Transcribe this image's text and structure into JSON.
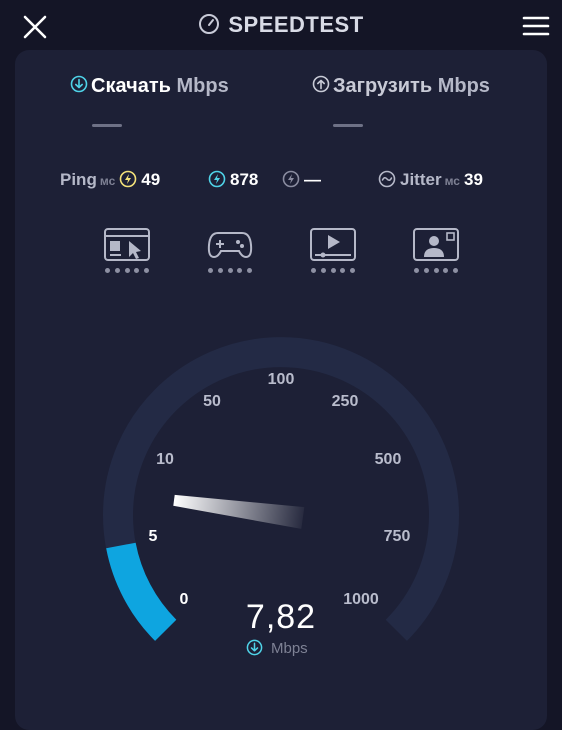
{
  "app": {
    "title": "SPEEDTEST"
  },
  "tabs": {
    "download": {
      "label": "Скачать",
      "unit": "Mbps"
    },
    "upload": {
      "label": "Загрузить",
      "unit": "Mbps"
    }
  },
  "stats": {
    "ping": {
      "label": "Ping",
      "unit": "мс",
      "value": "49"
    },
    "download_latency": {
      "value": "878"
    },
    "upload_latency": {
      "value": "—"
    },
    "jitter": {
      "label": "Jitter",
      "unit": "мс",
      "value": "39"
    }
  },
  "categories": [
    {
      "icon": "web-browsing-icon"
    },
    {
      "icon": "gaming-icon"
    },
    {
      "icon": "video-streaming-icon"
    },
    {
      "icon": "video-call-icon"
    }
  ],
  "gauge": {
    "ticks": [
      "0",
      "5",
      "10",
      "50",
      "100",
      "250",
      "500",
      "750",
      "1000"
    ],
    "current_value": "7,82",
    "unit": "Mbps"
  },
  "colors": {
    "background": "#141526",
    "card": "#1d2036",
    "gauge_track": "#232a45",
    "gauge_fill": "#0ea5e0",
    "ping_icon": "#f4e27a",
    "download_icon": "#4fd3e8",
    "upload_icon": "#8a8ca0"
  }
}
